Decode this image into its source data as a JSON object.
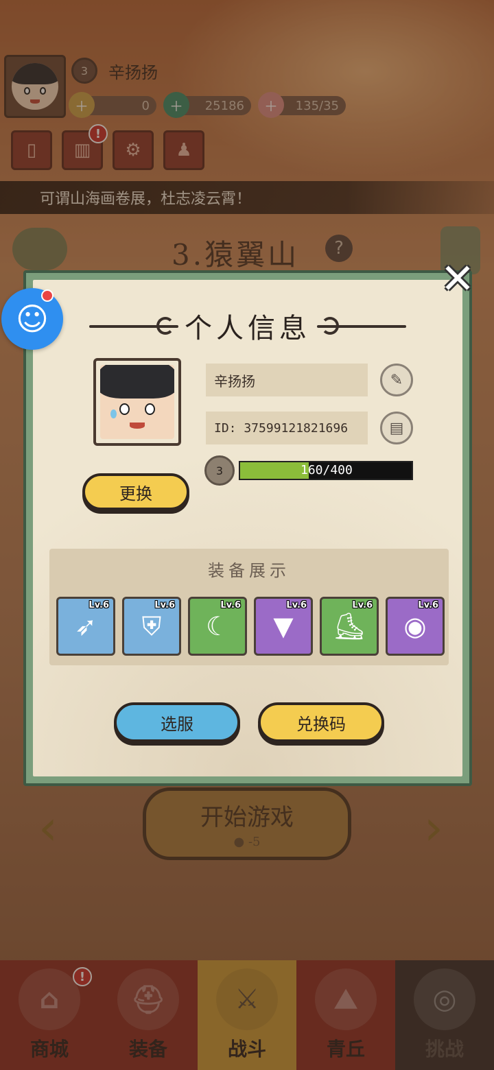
{
  "hud": {
    "level": "3",
    "player_name": "辛扬扬",
    "resources": [
      {
        "name": "gold",
        "value": "0",
        "icon": "gold-ticket-icon"
      },
      {
        "name": "jade",
        "value": "25186",
        "icon": "jade-dragon-icon"
      },
      {
        "name": "stamina",
        "value": "135/35",
        "icon": "peach-icon"
      }
    ],
    "buttons": [
      {
        "icon": "card-icon",
        "glyph": "▯",
        "alert": false
      },
      {
        "icon": "chart-icon",
        "glyph": "▥",
        "alert": true,
        "alert_text": "!"
      },
      {
        "icon": "settings-icon",
        "glyph": "⚙",
        "alert": false
      },
      {
        "icon": "friends-icon",
        "glyph": "♟",
        "alert": false
      }
    ]
  },
  "marquee": "可谓山海画卷展，杜志凌云霄！",
  "stage": {
    "title": "3.猿翼山",
    "help": "?"
  },
  "modal": {
    "title": "个人信息",
    "close": "✕",
    "name": "辛扬扬",
    "id_text": "ID: 37599121821696",
    "level": "3",
    "xp_text": "160/400",
    "xp_fraction": 0.4,
    "change_label": "更换",
    "equipment_title": "装备展示",
    "equipment": [
      {
        "level": "Lv.6",
        "rarity": "blue",
        "icon": "crossbow-icon",
        "glyph": "➶"
      },
      {
        "level": "Lv.6",
        "rarity": "blue",
        "icon": "armor-icon",
        "glyph": "⛨"
      },
      {
        "level": "Lv.6",
        "rarity": "green",
        "icon": "necklace-icon",
        "glyph": "☾"
      },
      {
        "level": "Lv.6",
        "rarity": "purple",
        "icon": "belt-icon",
        "glyph": "▼"
      },
      {
        "level": "Lv.6",
        "rarity": "green",
        "icon": "boots-icon",
        "glyph": "⛸"
      },
      {
        "level": "Lv.6",
        "rarity": "purple",
        "icon": "ring-icon",
        "glyph": "◉"
      }
    ],
    "select_server_label": "选服",
    "redeem_code_label": "兑换码"
  },
  "start": {
    "label": "开始游戏",
    "cost": "-5"
  },
  "nav": [
    {
      "label": "商城",
      "icon": "shop-icon",
      "style": "red",
      "alert": true
    },
    {
      "label": "装备",
      "icon": "helmet-icon",
      "style": "red",
      "alert": false
    },
    {
      "label": "战斗",
      "icon": "swords-icon",
      "style": "active",
      "alert": false
    },
    {
      "label": "青丘",
      "icon": "mountain-icon",
      "style": "red",
      "alert": false
    },
    {
      "label": "挑战",
      "icon": "challenge-icon",
      "style": "dark",
      "alert": false
    }
  ],
  "nav_alert_text": "!",
  "colors": {
    "modal_frame": "#7b9e7c",
    "paper": "#efe6d1",
    "xp_fill": "#8bbd3a",
    "yellow_button": "#f4cc50",
    "blue_button": "#5eb6e0"
  }
}
